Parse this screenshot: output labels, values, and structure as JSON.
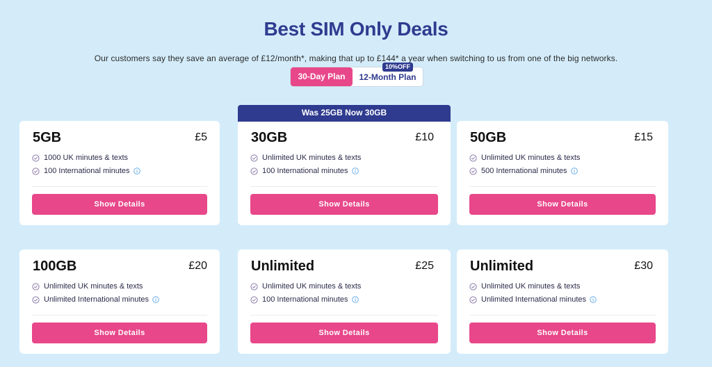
{
  "header": {
    "title": "Best SIM Only Deals",
    "subtitle": "Our customers say they save an average of £12/month*, making that up to £144* a year when switching to us from one of the big networks."
  },
  "toggle": {
    "plan_30": "30-Day Plan",
    "plan_12": "12-Month Plan",
    "discount": "10%OFF",
    "selected": "30-Day Plan"
  },
  "colors": {
    "accent_pink": "#e8478a",
    "navy": "#2f3b8f",
    "background": "#d4ecfa"
  },
  "cards": [
    {
      "title": "5GB",
      "price": "£5",
      "feature1": "1000 UK minutes & texts",
      "feature2": "100 International minutes",
      "button": "Show Details"
    },
    {
      "title": "30GB",
      "price": "£10",
      "banner": "Was 25GB Now 30GB",
      "feature1": "Unlimited UK minutes & texts",
      "feature2": "100 International minutes",
      "button": "Show Details"
    },
    {
      "title": "50GB",
      "price": "£15",
      "feature1": "Unlimited UK minutes & texts",
      "feature2": "500 International minutes",
      "button": "Show Details"
    },
    {
      "title": "100GB",
      "price": "£20",
      "feature1": "Unlimited UK minutes & texts",
      "feature2": "Unlimited International minutes",
      "button": "Show Details"
    },
    {
      "title": "Unlimited",
      "price": "£25",
      "feature1": "Unlimited UK minutes & texts",
      "feature2": "100 International minutes",
      "button": "Show Details"
    },
    {
      "title": "Unlimited",
      "price": "£30",
      "feature1": "Unlimited UK minutes & texts",
      "feature2": "Unlimited International minutes",
      "button": "Show Details"
    }
  ]
}
